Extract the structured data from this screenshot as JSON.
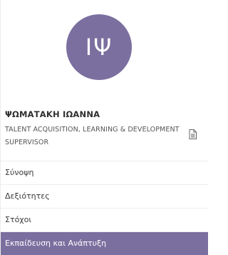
{
  "profile": {
    "initials": "ΙΨ",
    "name": "ΨΩΜΑΤΑΚΗ ΙΩΑΝΝΑ",
    "title": "TALENT ACQUISITION, LEARNING & DEVELOPMENT SUPERVISOR",
    "avatar_color": "#7b6f9f",
    "action_icon": "document-icon"
  },
  "menu": {
    "items": [
      {
        "label": "Σύνοψη",
        "active": false
      },
      {
        "label": "Δεξιότητες",
        "active": false
      },
      {
        "label": "Στόχοι",
        "active": false
      },
      {
        "label": "Εκπαίδευση και Ανάπτυξη",
        "active": true
      }
    ],
    "active_color": "#7b6f9f"
  }
}
